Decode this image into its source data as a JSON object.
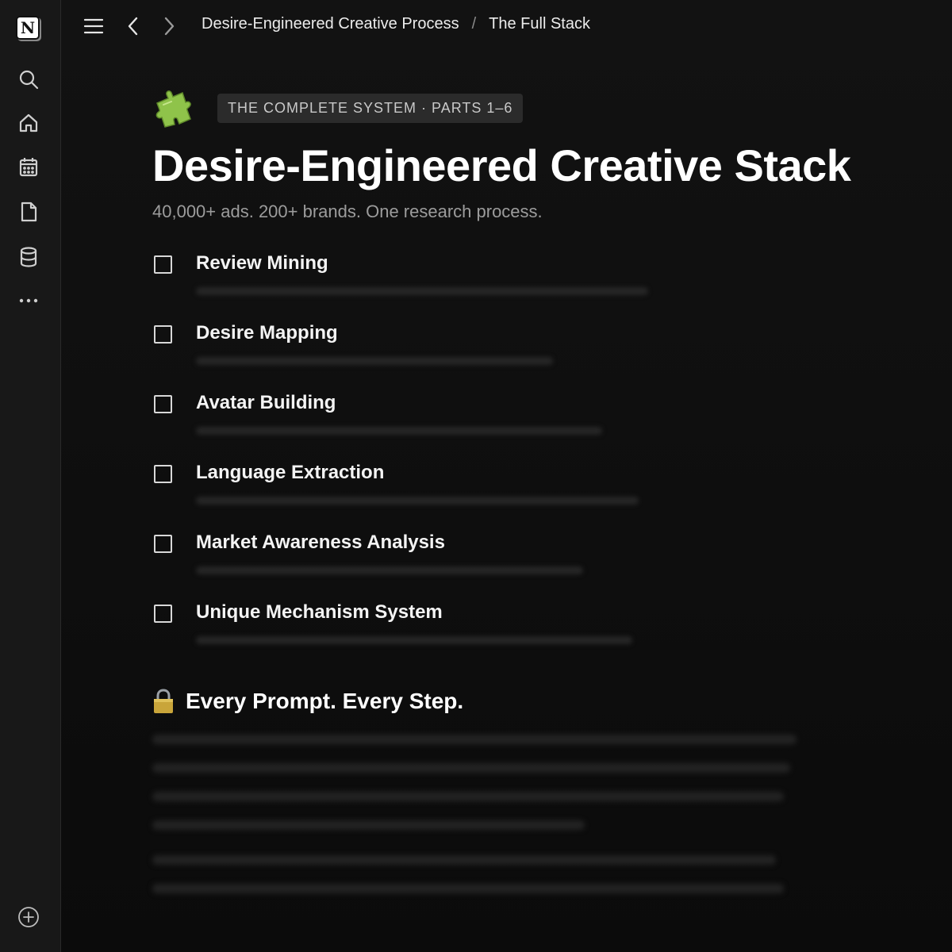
{
  "sidebar": {
    "logo": "N",
    "icons": [
      "search-icon",
      "home-icon",
      "calendar-icon",
      "page-icon",
      "database-icon",
      "more-icon"
    ],
    "bottom_icon": "add-icon"
  },
  "topbar": {
    "icons": [
      "menu-icon",
      "back-icon",
      "forward-icon"
    ],
    "breadcrumb": {
      "parent": "Desire-Engineered Creative Process",
      "separator": "/",
      "current": "The Full Stack"
    }
  },
  "page": {
    "icon": "puzzle-piece-icon",
    "badge": "THE COMPLETE SYSTEM · PARTS 1–6",
    "title": "Desire-Engineered Creative Stack",
    "subtitle": "40,000+ ads. 200+ brands. One research process.",
    "todos": [
      {
        "label": "Review Mining",
        "checked": false
      },
      {
        "label": "Desire Mapping",
        "checked": false
      },
      {
        "label": "Avatar Building",
        "checked": false
      },
      {
        "label": "Language Extraction",
        "checked": false
      },
      {
        "label": "Market Awareness Analysis",
        "checked": false
      },
      {
        "label": "Unique Mechanism System",
        "checked": false
      }
    ],
    "locked_section": {
      "icon": "lock-icon",
      "title": "Every Prompt. Every Step."
    }
  },
  "colors": {
    "background": "#0c0c0c",
    "sidebar": "#181818",
    "badge_bg": "#2b2b2b",
    "puzzle": "#8fc34a",
    "lock": "#c9a53a"
  }
}
